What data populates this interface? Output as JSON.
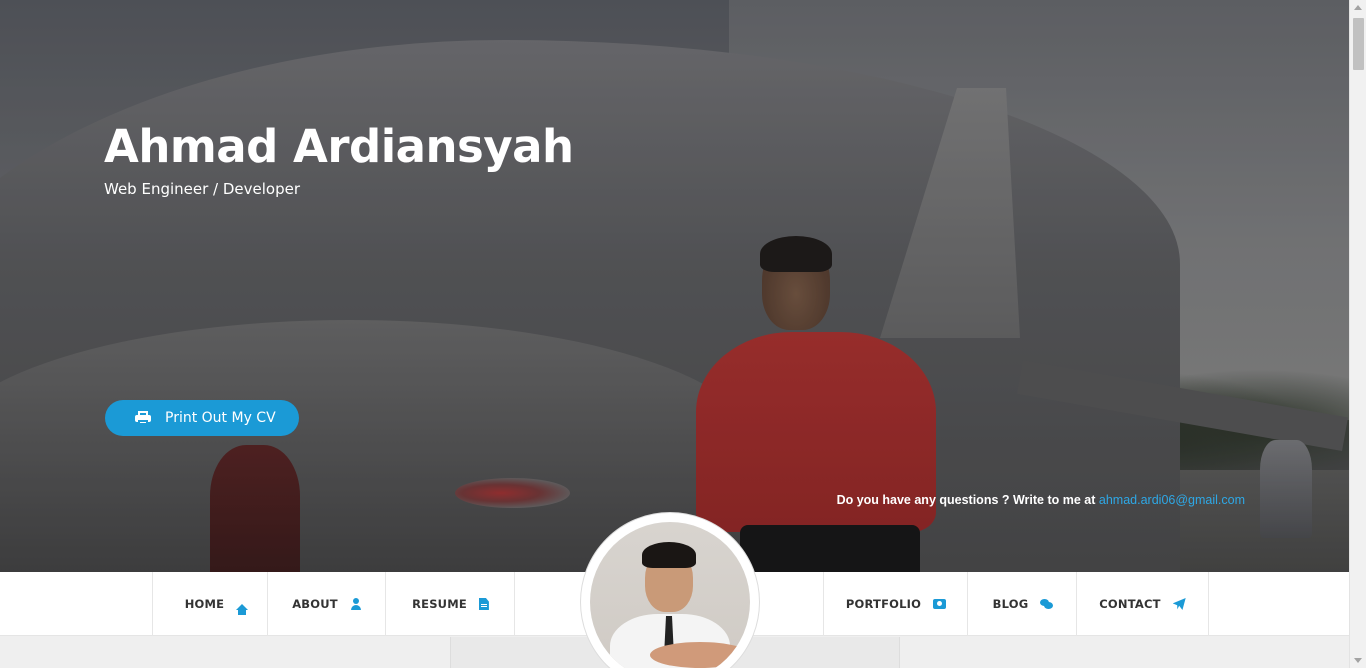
{
  "hero": {
    "name": "Ahmad Ardiansyah",
    "role": "Web Engineer / Developer",
    "cv_button_label": "Print Out My CV",
    "contact_prompt": "Do you have any questions ? Write to me at",
    "contact_email": "ahmad.ardi06@gmail.com"
  },
  "nav": {
    "items": [
      {
        "label": "HOME",
        "icon": "home-icon"
      },
      {
        "label": "ABOUT",
        "icon": "user-icon"
      },
      {
        "label": "RESUME",
        "icon": "file-icon"
      },
      {
        "label": "PORTFOLIO",
        "icon": "camera-icon"
      },
      {
        "label": "BLOG",
        "icon": "comments-icon"
      },
      {
        "label": "CONTACT",
        "icon": "paper-plane-icon"
      }
    ]
  },
  "colors": {
    "accent": "#1b9ad6",
    "link": "#2ea8e6",
    "nav_text": "#333333"
  }
}
